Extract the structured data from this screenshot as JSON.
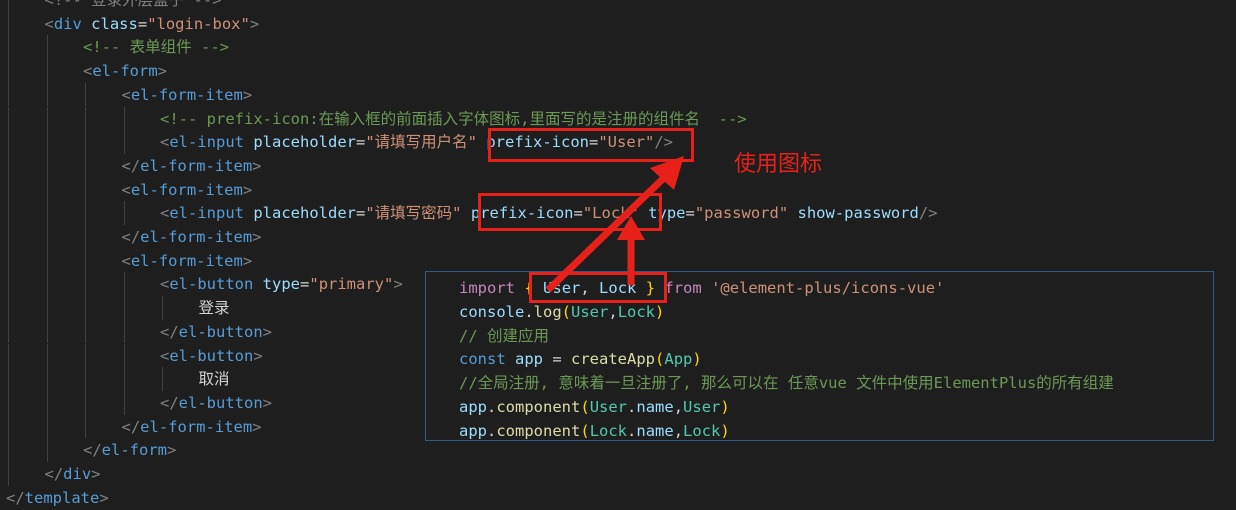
{
  "editor": {
    "lines": [
      {
        "indent": 1,
        "parts": [
          [
            "pun",
            "<!-- 登录外层盒子 -->"
          ]
        ]
      },
      {
        "indent": 1,
        "parts": [
          [
            "pun",
            "<"
          ],
          [
            "tag",
            "div"
          ],
          [
            "attr",
            " class"
          ],
          [
            "txt",
            "="
          ],
          [
            "str",
            "\"login-box\""
          ],
          [
            "pun",
            ">"
          ]
        ]
      },
      {
        "indent": 2,
        "parts": [
          [
            "cmt",
            "<!-- 表单组件 -->"
          ]
        ]
      },
      {
        "indent": 2,
        "parts": [
          [
            "pun",
            "<"
          ],
          [
            "tag",
            "el-form"
          ],
          [
            "pun",
            ">"
          ]
        ]
      },
      {
        "indent": 3,
        "parts": [
          [
            "pun",
            "<"
          ],
          [
            "tag",
            "el-form-item"
          ],
          [
            "pun",
            ">"
          ]
        ]
      },
      {
        "indent": 4,
        "parts": [
          [
            "cmt",
            "<!-- prefix-icon:在输入框的前面插入字体图标,里面写的是注册的组件名  -->"
          ]
        ]
      },
      {
        "indent": 4,
        "parts": [
          [
            "pun",
            "<"
          ],
          [
            "tag",
            "el-input"
          ],
          [
            "attr",
            " placeholder"
          ],
          [
            "txt",
            "="
          ],
          [
            "str",
            "\"请填写用户名\""
          ],
          [
            "attr",
            " prefix-icon"
          ],
          [
            "txt",
            "="
          ],
          [
            "str",
            "\"User\""
          ],
          [
            "pun",
            "/>"
          ]
        ]
      },
      {
        "indent": 3,
        "parts": [
          [
            "pun",
            "</"
          ],
          [
            "tag",
            "el-form-item"
          ],
          [
            "pun",
            ">"
          ]
        ]
      },
      {
        "indent": 3,
        "parts": [
          [
            "pun",
            "<"
          ],
          [
            "tag",
            "el-form-item"
          ],
          [
            "pun",
            ">"
          ]
        ]
      },
      {
        "indent": 4,
        "parts": [
          [
            "pun",
            "<"
          ],
          [
            "tag",
            "el-input"
          ],
          [
            "attr",
            " placeholder"
          ],
          [
            "txt",
            "="
          ],
          [
            "str",
            "\"请填写密码\""
          ],
          [
            "attr",
            " prefix-icon"
          ],
          [
            "txt",
            "="
          ],
          [
            "str",
            "\"Lock\""
          ],
          [
            "attr",
            " type"
          ],
          [
            "txt",
            "="
          ],
          [
            "str",
            "\"password\""
          ],
          [
            "attr",
            " show-password"
          ],
          [
            "pun",
            "/>"
          ]
        ]
      },
      {
        "indent": 3,
        "parts": [
          [
            "pun",
            "</"
          ],
          [
            "tag",
            "el-form-item"
          ],
          [
            "pun",
            ">"
          ]
        ]
      },
      {
        "indent": 3,
        "parts": [
          [
            "pun",
            "<"
          ],
          [
            "tag",
            "el-form-item"
          ],
          [
            "pun",
            ">"
          ]
        ]
      },
      {
        "indent": 4,
        "parts": [
          [
            "pun",
            "<"
          ],
          [
            "tag",
            "el-button"
          ],
          [
            "attr",
            " type"
          ],
          [
            "txt",
            "="
          ],
          [
            "str",
            "\"primary\""
          ],
          [
            "pun",
            ">"
          ]
        ]
      },
      {
        "indent": 5,
        "parts": [
          [
            "txt",
            "登录"
          ]
        ]
      },
      {
        "indent": 4,
        "parts": [
          [
            "pun",
            "</"
          ],
          [
            "tag",
            "el-button"
          ],
          [
            "pun",
            ">"
          ]
        ]
      },
      {
        "indent": 4,
        "parts": [
          [
            "pun",
            "<"
          ],
          [
            "tag",
            "el-button"
          ],
          [
            "pun",
            ">"
          ]
        ]
      },
      {
        "indent": 5,
        "parts": [
          [
            "txt",
            "取消"
          ]
        ]
      },
      {
        "indent": 4,
        "parts": [
          [
            "pun",
            "</"
          ],
          [
            "tag",
            "el-button"
          ],
          [
            "pun",
            ">"
          ]
        ]
      },
      {
        "indent": 3,
        "parts": [
          [
            "pun",
            "</"
          ],
          [
            "tag",
            "el-form-item"
          ],
          [
            "pun",
            ">"
          ]
        ]
      },
      {
        "indent": 2,
        "parts": [
          [
            "pun",
            "</"
          ],
          [
            "tag",
            "el-form"
          ],
          [
            "pun",
            ">"
          ]
        ]
      },
      {
        "indent": 1,
        "parts": [
          [
            "pun",
            "</"
          ],
          [
            "tag",
            "div"
          ],
          [
            "pun",
            ">"
          ]
        ]
      },
      {
        "indent": 0,
        "parts": [
          [
            "pun",
            "</"
          ],
          [
            "tag",
            "template"
          ],
          [
            "pun",
            ">"
          ]
        ]
      }
    ]
  },
  "popup": {
    "lines": [
      [
        [
          "kw",
          "import"
        ],
        [
          "op",
          " "
        ],
        [
          "brk",
          "{"
        ],
        [
          "op",
          " "
        ],
        [
          "var",
          "User"
        ],
        [
          "op",
          ", "
        ],
        [
          "var",
          "Lock"
        ],
        [
          "op",
          " "
        ],
        [
          "brk",
          "}"
        ],
        [
          "op",
          " "
        ],
        [
          "kw",
          "from"
        ],
        [
          "op",
          " "
        ],
        [
          "str",
          "'@element-plus/icons-vue'"
        ]
      ],
      [
        [
          "var",
          "console"
        ],
        [
          "op",
          "."
        ],
        [
          "fn",
          "log"
        ],
        [
          "brk",
          "("
        ],
        [
          "cls",
          "User"
        ],
        [
          "op",
          ","
        ],
        [
          "cls",
          "Lock"
        ],
        [
          "brk",
          ")"
        ]
      ],
      [
        [
          "cmt",
          "// 创建应用"
        ]
      ],
      [
        [
          "tag",
          "const"
        ],
        [
          "op",
          " "
        ],
        [
          "var",
          "app"
        ],
        [
          "op",
          " = "
        ],
        [
          "fn",
          "createApp"
        ],
        [
          "brk",
          "("
        ],
        [
          "cls",
          "App"
        ],
        [
          "brk",
          ")"
        ]
      ],
      [
        [
          "cmt",
          "//全局注册, 意味着一旦注册了, 那么可以在 任意vue 文件中使用ElementPlus的所有组建"
        ]
      ],
      [
        [
          "var",
          "app"
        ],
        [
          "op",
          "."
        ],
        [
          "fn",
          "component"
        ],
        [
          "brk",
          "("
        ],
        [
          "cls",
          "User"
        ],
        [
          "op",
          "."
        ],
        [
          "var",
          "name"
        ],
        [
          "op",
          ","
        ],
        [
          "cls",
          "User"
        ],
        [
          "brk",
          ")"
        ]
      ],
      [
        [
          "var",
          "app"
        ],
        [
          "op",
          "."
        ],
        [
          "fn",
          "component"
        ],
        [
          "brk",
          "("
        ],
        [
          "cls",
          "Lock"
        ],
        [
          "op",
          "."
        ],
        [
          "var",
          "name"
        ],
        [
          "op",
          ","
        ],
        [
          "cls",
          "Lock"
        ],
        [
          "brk",
          ")"
        ]
      ]
    ]
  },
  "annotation": {
    "label": "使用图标",
    "color": "#e8201a"
  }
}
